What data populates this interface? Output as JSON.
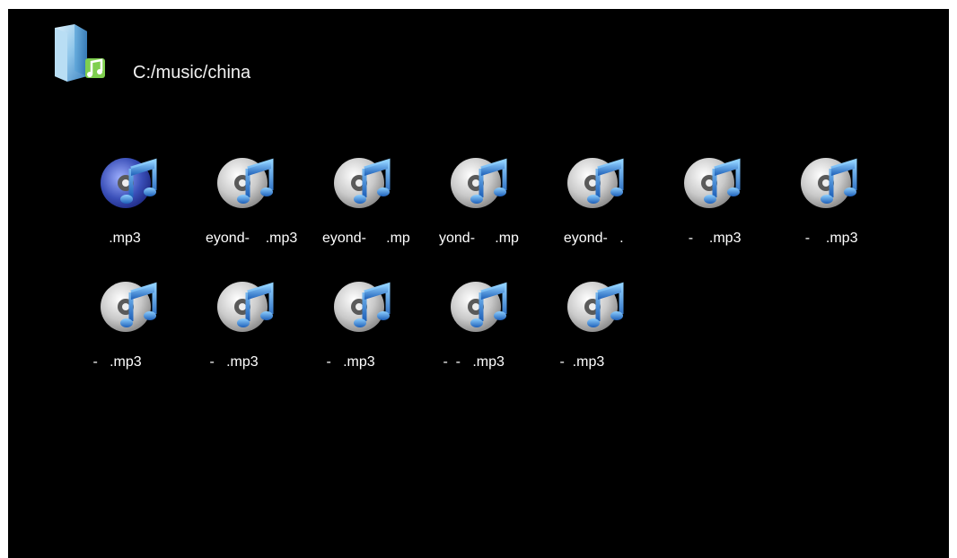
{
  "header": {
    "path": "C:/music/china",
    "icon": "music-folder-icon"
  },
  "files": [
    {
      "label": "     .mp3",
      "icon": "music-file-icon",
      "selected": true
    },
    {
      "label": "eyond-    .mp3",
      "icon": "music-file-icon",
      "selected": false
    },
    {
      "label": "eyond-     .mp",
      "icon": "music-file-icon",
      "selected": false
    },
    {
      "label": "yond-     .mp",
      "icon": "music-file-icon",
      "selected": false
    },
    {
      "label": "  eyond-   .",
      "icon": "music-file-icon",
      "selected": false
    },
    {
      "label": "    -    .mp3",
      "icon": "music-file-icon",
      "selected": false
    },
    {
      "label": "    -    .mp3",
      "icon": "music-file-icon",
      "selected": false
    },
    {
      "label": " -   .mp3",
      "icon": "music-file-icon",
      "selected": false
    },
    {
      "label": " -   .mp3",
      "icon": "music-file-icon",
      "selected": false
    },
    {
      "label": " -   .mp3",
      "icon": "music-file-icon",
      "selected": false
    },
    {
      "label": " -  -   .mp3",
      "icon": "music-file-icon",
      "selected": false
    },
    {
      "label": " -  .mp3",
      "icon": "music-file-icon",
      "selected": false
    }
  ],
  "colors": {
    "background": "#000000",
    "text": "#ffffff",
    "note_blue": "#2f7fd6",
    "disc_silver": "#c8c8c8",
    "selected_disc": "#3a4fb8"
  }
}
